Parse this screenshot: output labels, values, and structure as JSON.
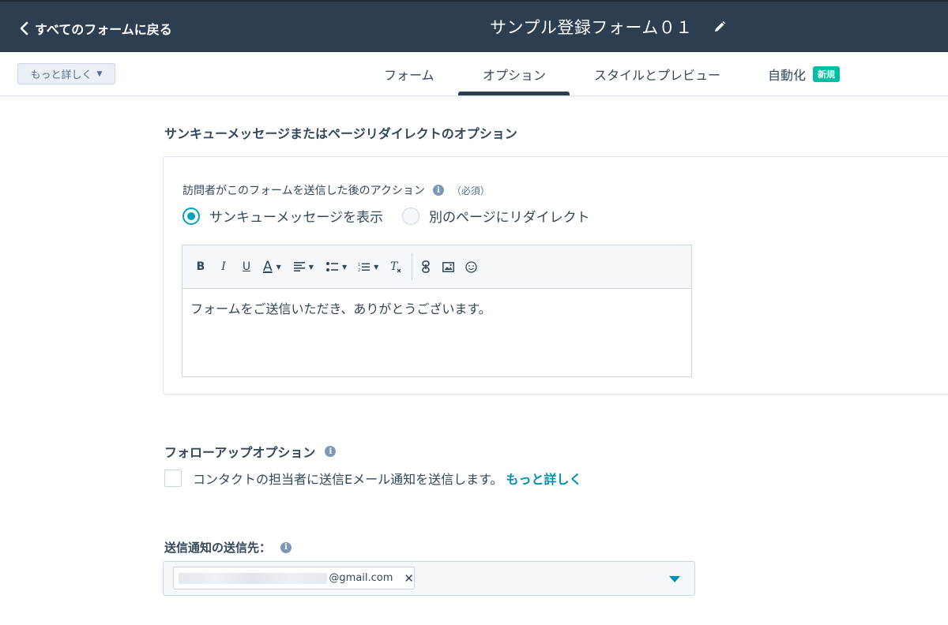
{
  "header": {
    "back_label": "すべてのフォームに戻る",
    "form_title": "サンプル登録フォーム０１"
  },
  "subnav": {
    "more_label": "もっと詳しく",
    "tabs": [
      {
        "label": "フォーム",
        "active": false
      },
      {
        "label": "オプション",
        "active": true
      },
      {
        "label": "スタイルとプレビュー",
        "active": false
      },
      {
        "label": "自動化",
        "active": false,
        "badge": "新規"
      }
    ]
  },
  "thanks_section": {
    "title": "サンキューメッセージまたはページリダイレクトのオプション",
    "field_label": "訪問者がこのフォームを送信した後のアクション",
    "required": "（必須）",
    "options": [
      {
        "label": "サンキューメッセージを表示",
        "selected": true
      },
      {
        "label": "別のページにリダイレクト",
        "selected": false
      }
    ],
    "message": "フォームをご送信いただき、ありがとうございます。"
  },
  "followup_section": {
    "title": "フォローアップオプション",
    "checkbox_label": "コンタクトの担当者に送信Eメール通知を送信します。",
    "learn_more": "もっと詳しく",
    "checked": false
  },
  "recipients_section": {
    "title": "送信通知の送信先：",
    "email_domain": "@gmail.com",
    "remove_glyph": "✕"
  },
  "colors": {
    "header_bg": "#2d3e50",
    "accent": "#00a4bd",
    "link": "#0091ae",
    "badge": "#00bda5"
  }
}
